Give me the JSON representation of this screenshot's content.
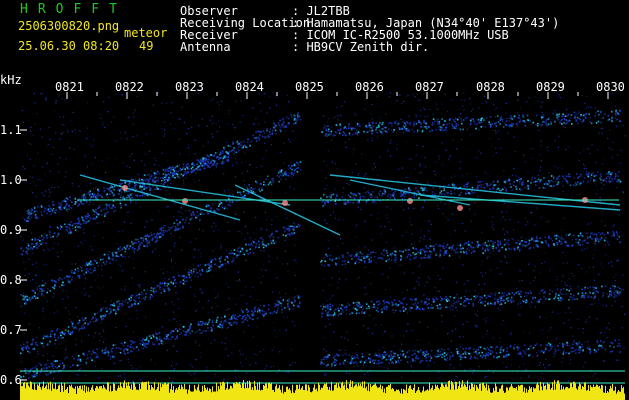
{
  "header": {
    "app_title": "HROFFT",
    "filename": "2506300820.png",
    "meteor_label": "meteor",
    "datetime": "25.06.30 08:20",
    "meteor_count": "49",
    "fields": [
      {
        "label": "Observer",
        "value": ": JL2TBB"
      },
      {
        "label": "Receiving Location",
        "value": ": Hamamatsu, Japan (N34°40' E137°43')"
      },
      {
        "label": "Receiver",
        "value": ": ICOM IC-R2500 53.1000MHz USB"
      },
      {
        "label": "Antenna",
        "value": ": HB9CV Zenith dir."
      }
    ]
  },
  "spectrogram": {
    "y_unit": "kHz",
    "time_ticks": [
      "0821",
      "0822",
      "0823",
      "0824",
      "0825",
      "0826",
      "0827",
      "0828",
      "0829",
      "0830"
    ],
    "freq_ticks": [
      "1.1",
      "1.0",
      "0.9",
      "0.8",
      "0.7",
      "0.6"
    ],
    "colors": {
      "background": "#000000",
      "noise": "#1e3cc8",
      "signal": "#28c8e6",
      "ref_line": "#3cf0c8",
      "activity": "#f0e614",
      "tick": "#ffffff"
    }
  }
}
